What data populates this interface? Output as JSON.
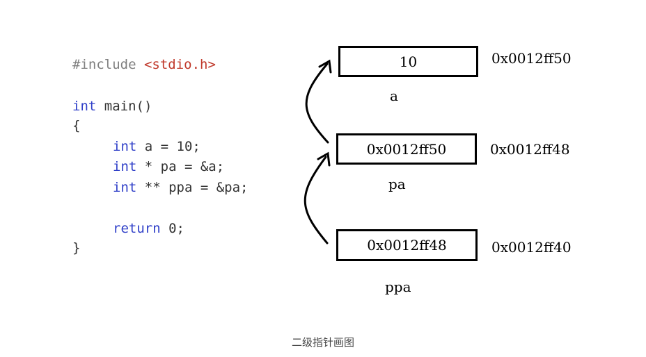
{
  "code": {
    "include_directive": "#include",
    "include_header": "<stdio.h>",
    "main_type": "int",
    "main_sig": " main()",
    "open_brace": "{",
    "line_a_type": "int",
    "line_a_rest": " a = 10;",
    "line_pa_type": "int",
    "line_pa_rest": " * pa = &a;",
    "line_ppa_type": "int",
    "line_ppa_rest": " ** ppa = &pa;",
    "return_kw": "return",
    "return_rest": " 0;",
    "close_brace": "}"
  },
  "memory": [
    {
      "name": "a",
      "value": "10",
      "address": "0x0012ff50"
    },
    {
      "name": "pa",
      "value": "0x0012ff50",
      "address": "0x0012ff48"
    },
    {
      "name": "ppa",
      "value": "0x0012ff48",
      "address": "0x0012ff40"
    }
  ],
  "caption": "二级指针画图"
}
